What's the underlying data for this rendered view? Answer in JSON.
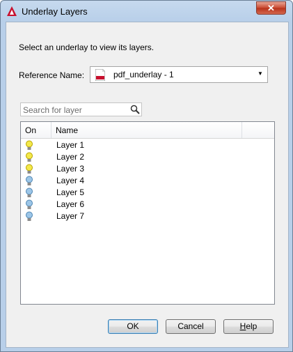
{
  "window": {
    "title": "Underlay Layers",
    "close_symbol": "✕",
    "accent": "#c9482f"
  },
  "dialog": {
    "instruction": "Select an underlay to view its layers.",
    "reference_label": "Reference Name:",
    "reference_value": "pdf_underlay - 1",
    "reference_icon": "pdf-file-icon"
  },
  "search": {
    "placeholder": "Search for layer",
    "icon": "magnifier-icon"
  },
  "list": {
    "columns": [
      "On",
      "Name"
    ],
    "rows": [
      {
        "name": "Layer 1",
        "on": true
      },
      {
        "name": "Layer 2",
        "on": true
      },
      {
        "name": "Layer 3",
        "on": true
      },
      {
        "name": "Layer 4",
        "on": false
      },
      {
        "name": "Layer 5",
        "on": false
      },
      {
        "name": "Layer 6",
        "on": false
      },
      {
        "name": "Layer 7",
        "on": false
      }
    ],
    "bulb_on_color": "#f4e94a",
    "bulb_off_color": "#9cc6e8"
  },
  "buttons": {
    "ok": "OK",
    "cancel": "Cancel",
    "help": "Help"
  }
}
